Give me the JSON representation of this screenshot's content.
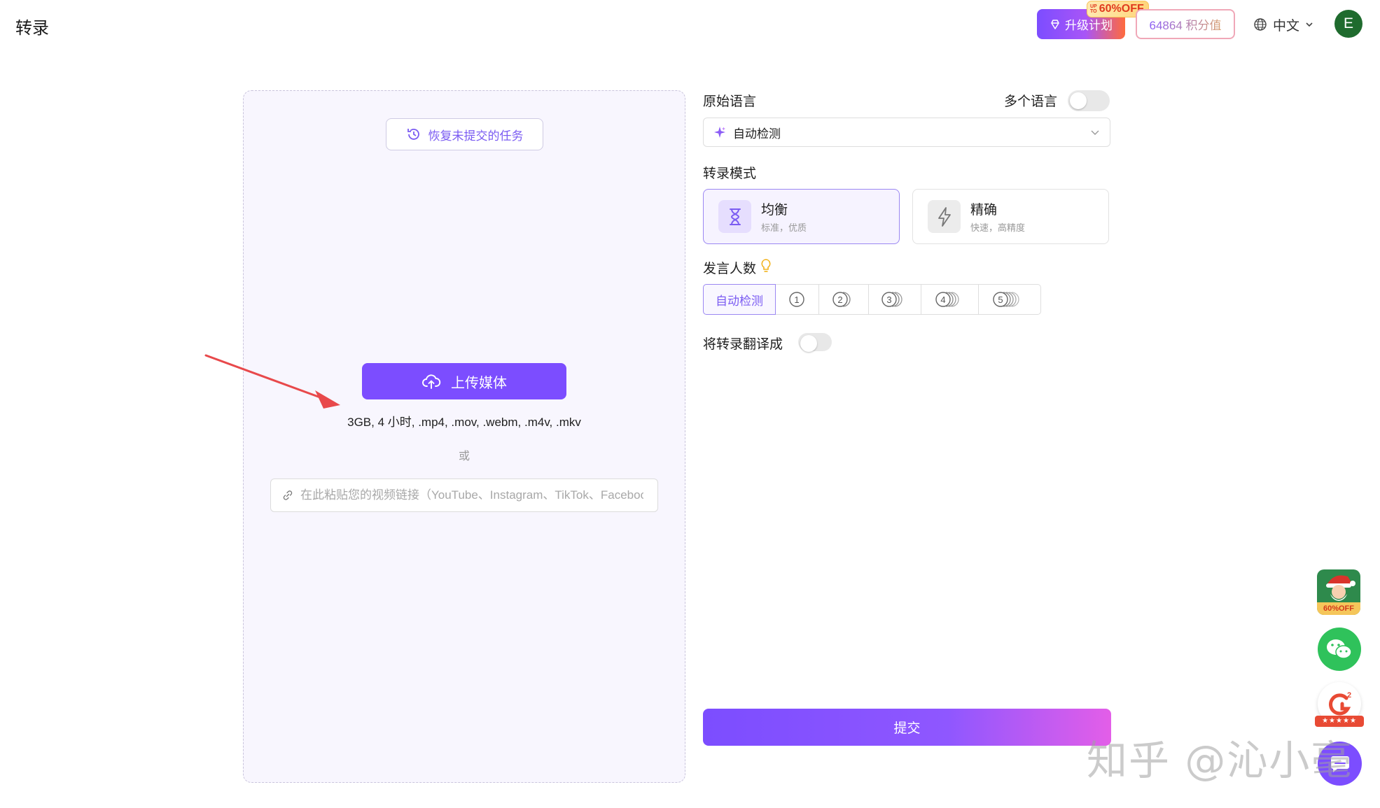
{
  "header": {
    "title": "转录",
    "upgrade_label": "升级计划",
    "promo_upto": [
      "UP",
      "TO"
    ],
    "promo_text": "60%OFF",
    "credits_label": "64864 积分值",
    "language_label": "中文",
    "avatar_initial": "E"
  },
  "upload": {
    "restore_label": "恢复未提交的任务",
    "upload_label": "上传媒体",
    "formats_text": "3GB, 4 小时, .mp4, .mov, .webm, .m4v, .mkv",
    "or_text": "或",
    "link_placeholder": "在此粘贴您的视频链接（YouTube、Instagram、TikTok、Facebook"
  },
  "settings": {
    "source_language_label": "原始语言",
    "multi_language_label": "多个语言",
    "multi_language_on": false,
    "source_language_value": "自动检测",
    "mode_label": "转录模式",
    "modes": [
      {
        "title": "均衡",
        "subtitle": "标准，优质",
        "selected": true
      },
      {
        "title": "精确",
        "subtitle": "快速，高精度",
        "selected": false
      }
    ],
    "speakers_label": "发言人数",
    "speaker_options": [
      "自动检测",
      "1",
      "2",
      "3",
      "4",
      "5"
    ],
    "speaker_selected": "自动检测",
    "translate_label": "将转录翻译成",
    "translate_on": false,
    "submit_label": "提交"
  },
  "floating": {
    "promo_badge": "60%OFF",
    "g2_label": "2",
    "g2_stars": "★★★★★"
  },
  "watermark": "知乎 @沁小毫",
  "colors": {
    "accent": "#7c4dff",
    "accent_light": "#f6f3ff",
    "promo_red": "#e03a1e",
    "arrow_red": "#e8494b",
    "wechat_green": "#2fc25b"
  }
}
